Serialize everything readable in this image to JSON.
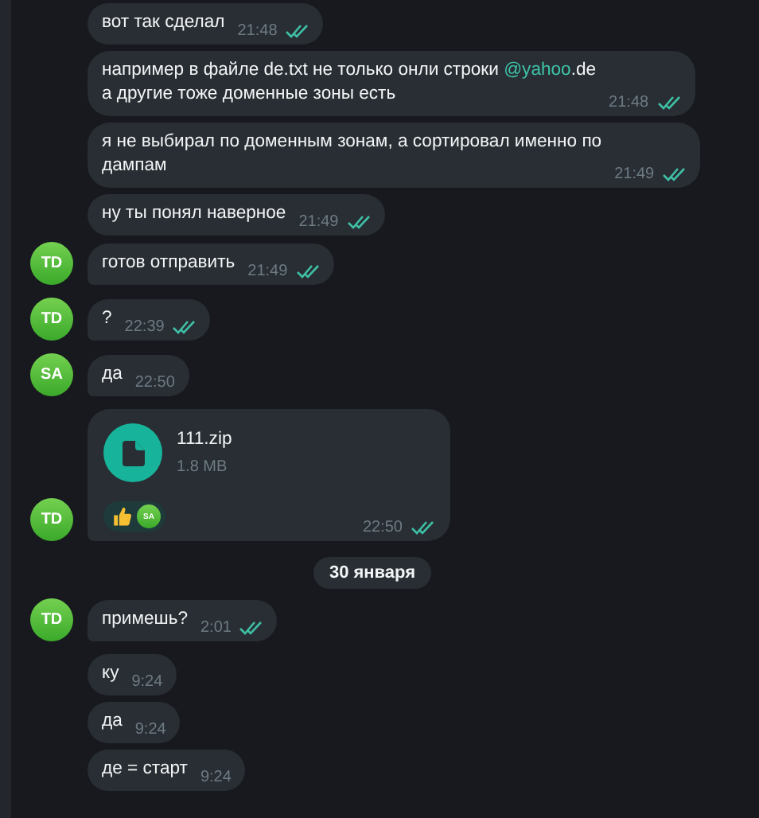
{
  "messages": [
    {
      "lines": [
        [
          {
            "kind": "plain",
            "text": "вот так сделал"
          }
        ]
      ],
      "time": "21:48",
      "read": true,
      "tail": false
    },
    {
      "lines": [
        [
          {
            "kind": "plain",
            "text": "например в файле de.txt не только онли строки "
          },
          {
            "kind": "mention",
            "text": "@yahoo"
          },
          {
            "kind": "plain",
            "text": ".de"
          }
        ],
        [
          {
            "kind": "plain",
            "text": "а другие тоже доменные зоны есть"
          }
        ]
      ],
      "time": "21:48",
      "read": true,
      "tail": false
    },
    {
      "lines": [
        [
          {
            "kind": "plain",
            "text": "я не выбирал по доменным зонам, а сортировал именно по"
          }
        ],
        [
          {
            "kind": "plain",
            "text": "дампам"
          }
        ]
      ],
      "time": "21:49",
      "read": true,
      "tail": false
    },
    {
      "lines": [
        [
          {
            "kind": "plain",
            "text": "ну ты понял наверное"
          }
        ]
      ],
      "time": "21:49",
      "read": true,
      "tail": false
    },
    {
      "lines": [
        [
          {
            "kind": "plain",
            "text": "готов отправить"
          }
        ]
      ],
      "time": "21:49",
      "read": true,
      "tail": true,
      "avatar": "TD"
    },
    {
      "lines": [
        [
          {
            "kind": "plain",
            "text": "?"
          }
        ]
      ],
      "time": "22:39",
      "read": true,
      "tail": true,
      "avatar": "TD"
    },
    {
      "lines": [
        [
          {
            "kind": "plain",
            "text": "да"
          }
        ]
      ],
      "time": "22:50",
      "read": false,
      "tail": true,
      "avatar": "SA"
    },
    {
      "kind": "file",
      "file": {
        "name": "111.zip",
        "size": "1.8 MB"
      },
      "reactions": [
        {
          "reactor": "SA"
        }
      ],
      "time": "22:50",
      "read": true,
      "tail": true,
      "avatar": "TD"
    },
    {
      "kind": "date",
      "label": "30 января"
    },
    {
      "lines": [
        [
          {
            "kind": "plain",
            "text": "примешь?"
          }
        ]
      ],
      "time": "2:01",
      "read": true,
      "tail": true,
      "avatar": "TD"
    },
    {
      "lines": [
        [
          {
            "kind": "plain",
            "text": "ку"
          }
        ]
      ],
      "time": "9:24",
      "read": false,
      "tail": false
    },
    {
      "lines": [
        [
          {
            "kind": "plain",
            "text": "да"
          }
        ]
      ],
      "time": "9:24",
      "read": false,
      "tail": false
    },
    {
      "lines": [
        [
          {
            "kind": "plain",
            "text": "де = старт"
          }
        ]
      ],
      "time": "9:24",
      "read": false,
      "tail": false
    }
  ]
}
